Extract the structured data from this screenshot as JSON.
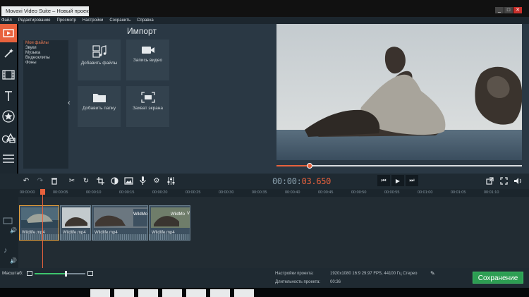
{
  "window": {
    "title": "Movavi Video Suite – Новый проект *",
    "controls": [
      "_",
      "□",
      "✕"
    ]
  },
  "menu": [
    "Файл",
    "Редактирование",
    "Просмотр",
    "Настройки",
    "Сохранить",
    "Справка"
  ],
  "sidebar": {
    "tools": [
      {
        "icon": "import-icon",
        "active": true
      },
      {
        "icon": "magic-wand-icon",
        "active": false
      },
      {
        "icon": "film-strip-icon",
        "active": false
      },
      {
        "icon": "text-icon",
        "active": false
      },
      {
        "icon": "star-sticker-icon",
        "active": false
      },
      {
        "icon": "transitions-shapes-icon",
        "active": false
      },
      {
        "icon": "list-icon",
        "active": false
      }
    ]
  },
  "import": {
    "title": "Импорт",
    "categories": [
      "Мои файлы",
      "Звуки",
      "Музыка",
      "Видеоклипы",
      "Фоны"
    ],
    "selected_category": "Мои файлы",
    "tiles": [
      {
        "label": "Добавить файлы",
        "icon": "add-files-icon"
      },
      {
        "label": "Запись видео",
        "icon": "video-camera-icon"
      },
      {
        "label": "Добавить папку",
        "icon": "folder-icon"
      },
      {
        "label": "Захват экрана",
        "icon": "screen-capture-icon"
      }
    ]
  },
  "player": {
    "timecode_prefix": "00:00:",
    "timecode_value": "03.650",
    "progress": 0.135
  },
  "timeline": {
    "ruler": [
      "00:00:00",
      "00:00:05",
      "00:00:10",
      "00:00:15",
      "00:00:20",
      "00:00:25",
      "00:00:30",
      "00:00:35",
      "00:00:40",
      "00:00:45",
      "00:00:50",
      "00:00:55",
      "00:01:00",
      "00:01:05",
      "00:01:10"
    ],
    "clips": [
      {
        "name": "Wildlife.mp4",
        "title_overlay": "",
        "selected": true
      },
      {
        "name": "Wildlife.mp4",
        "title_overlay": "",
        "selected": false
      },
      {
        "name": "Wildlife.mp4",
        "title_overlay": "WildMo",
        "selected": false
      },
      {
        "name": "Wildlife.mp4",
        "title_overlay": "WildMo",
        "selected": false
      }
    ],
    "clip_extra": "V"
  },
  "footer": {
    "zoom_label": "Масштаб:",
    "zoom_level": 0.61,
    "settings_label": "Настройки проекта:",
    "settings_value": "1920x1080 16:9 29.97 FPS, 44100 Гц Стерео",
    "duration_label": "Длительность проекта:",
    "duration_value": "00:36",
    "save_button": "Сохранение"
  },
  "colors": {
    "accent": "#e8623d",
    "save": "#2d9e53",
    "panel": "#2a3844"
  }
}
